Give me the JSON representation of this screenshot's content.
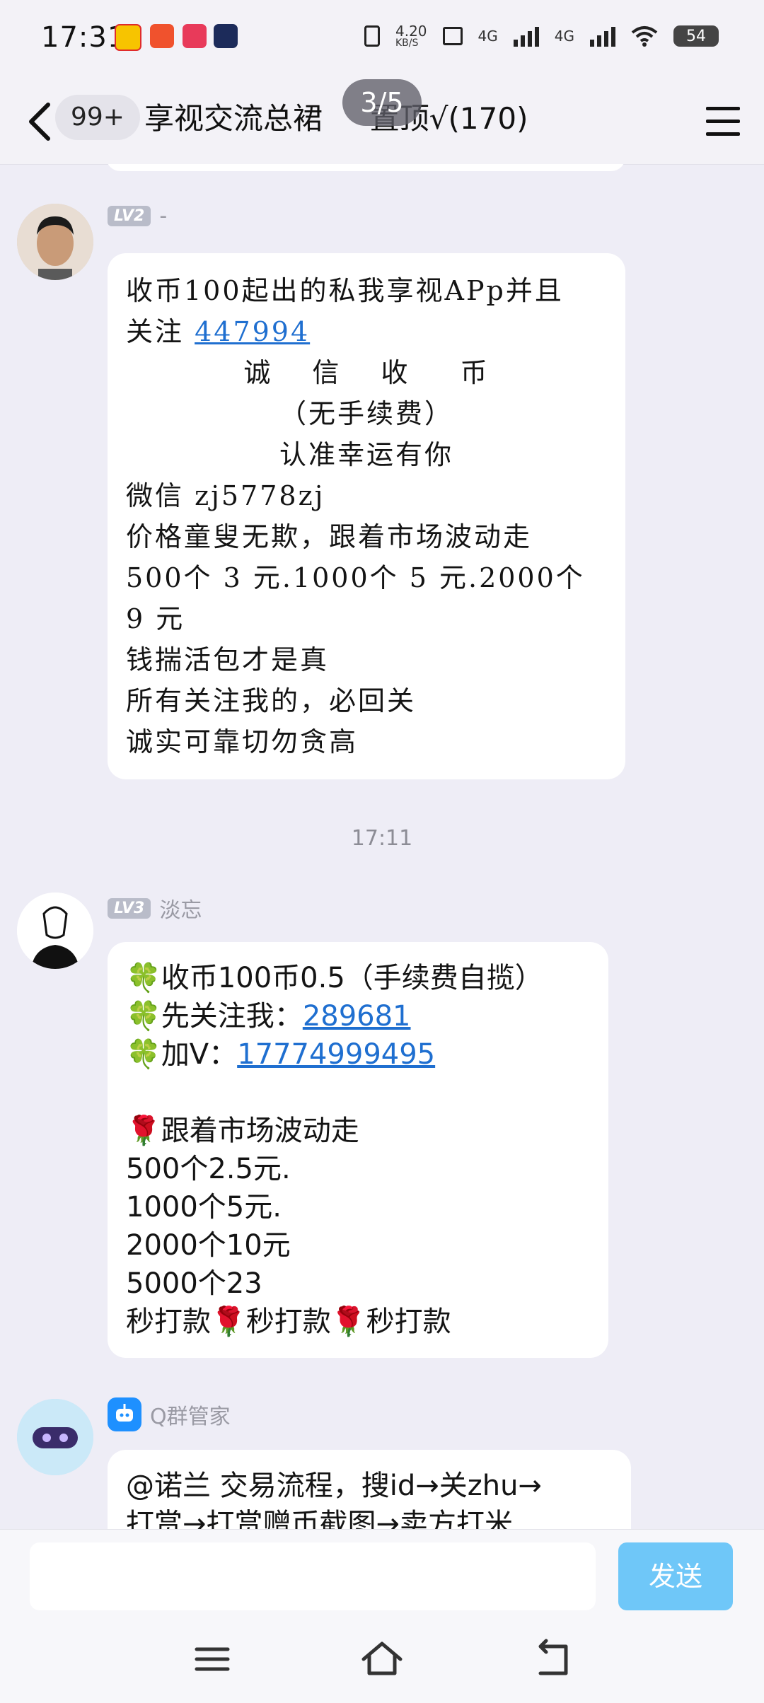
{
  "status_bar": {
    "time": "17:31",
    "net_speed_value": "4.20",
    "net_speed_unit": "KB/S",
    "sim1": "4G",
    "sim2": "4G",
    "battery": "54"
  },
  "header": {
    "unread_badge": "99+",
    "title": "享视交流总裙     置顶√(170)",
    "pager": "3/5"
  },
  "messages": [
    {
      "level": "LV2",
      "sender": "-",
      "style": "handwriting",
      "lines": [
        {
          "text": "收币100起出的私我享视APp并且"
        },
        {
          "text": "关注 ",
          "link": "447994"
        },
        {
          "text": "诚　 信　 收　  币",
          "align": "center"
        },
        {
          "text": "（无手续费）",
          "align": "center"
        },
        {
          "text": "认准幸运有你",
          "align": "center"
        },
        {
          "text": "微信 zj5778zj"
        },
        {
          "text": "价格童叟无欺，跟着市场波动走"
        },
        {
          "text": "500个 3 元.1000个 5 元.2000个"
        },
        {
          "text": "9 元"
        },
        {
          "text": "钱揣活包才是真"
        },
        {
          "text": "所有关注我的，必回关"
        },
        {
          "text": "诚实可靠切勿贪高"
        }
      ]
    },
    {
      "timestamp": "17:11",
      "level": "LV3",
      "sender": "淡忘",
      "lines": [
        {
          "emoji": "🍀",
          "text": "收币100币0.5（手续费自揽）"
        },
        {
          "emoji": "🍀",
          "text": "先关注我：",
          "link": "289681"
        },
        {
          "emoji": "🍀",
          "text": "加V：",
          "link": "17774999495"
        },
        {
          "text": ""
        },
        {
          "emoji": "🌹",
          "text": "跟着市场波动走"
        },
        {
          "text": "500个2.5元."
        },
        {
          "text": "1000个5元."
        },
        {
          "text": "2000个10元"
        },
        {
          "text": "5000个23"
        },
        {
          "text": "秒打款",
          "emoji_after": "🌹",
          "text2": "秒打款",
          "emoji_after2": "🌹",
          "text3": "秒打款"
        }
      ]
    },
    {
      "sender": "Q群管家",
      "lines": [
        {
          "text": "@诺兰 交易流程，搜id→关zhu→"
        },
        {
          "text": "打赏→打赏赠币截图→卖方打米"
        }
      ]
    }
  ],
  "input": {
    "placeholder": "",
    "send_label": "发送"
  },
  "nav": {
    "menu_icon": "menu-icon",
    "home_icon": "home-icon",
    "back_icon": "back-icon"
  }
}
